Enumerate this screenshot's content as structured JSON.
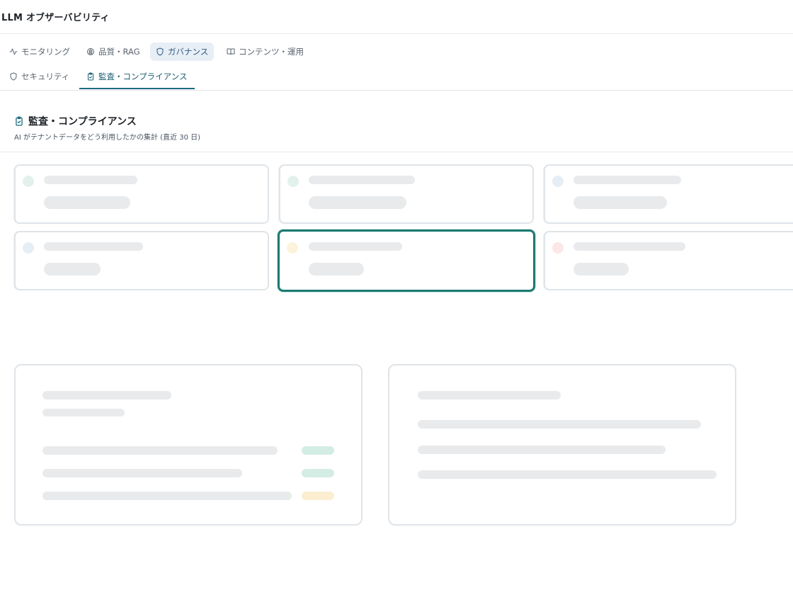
{
  "app": {
    "title": "LLM オブザーバビリティ"
  },
  "nav": {
    "tabs": [
      {
        "label": "モニタリング",
        "icon": "activity-icon"
      },
      {
        "label": "品質・RAG",
        "icon": "brain-icon"
      },
      {
        "label": "ガバナンス",
        "icon": "shield-icon",
        "active": true
      },
      {
        "label": "コンテンツ・運用",
        "icon": "book-open-icon"
      }
    ],
    "subtabs": [
      {
        "label": "セキュリティ",
        "icon": "shield-icon"
      },
      {
        "label": "監査・コンプライアンス",
        "icon": "clipboard-check-icon",
        "active": true
      }
    ]
  },
  "section": {
    "title": "監査・コンプライアンス",
    "subtitle": "AI がテナントデータをどう利用したかの集計 (直近 30 日)",
    "icon": "clipboard-check-icon"
  },
  "colors": {
    "accent": "#1c6b7f",
    "focus_ring": "#1b7a72",
    "dot_green": "#e3f1ec",
    "dot_blue": "#e6eef5",
    "dot_yellow": "#fbf3dc",
    "dot_red": "#fbe7e7",
    "badge_green": "#d3ece4",
    "badge_yellow": "#fbeed1"
  }
}
